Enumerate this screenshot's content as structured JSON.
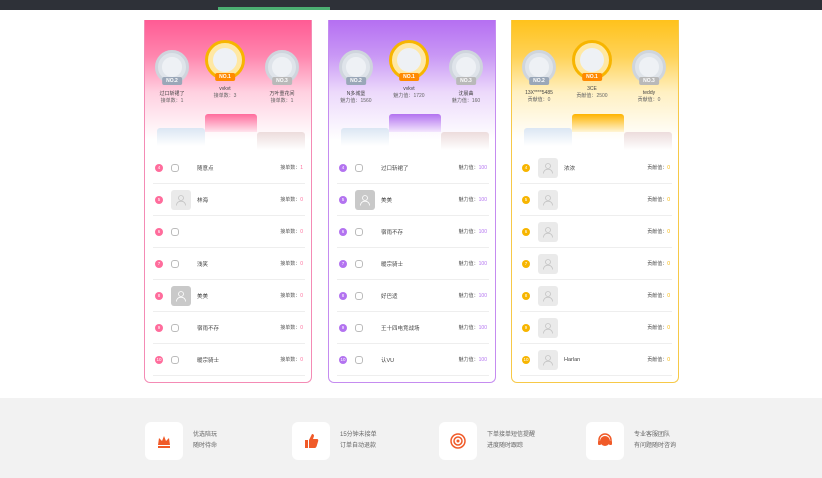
{
  "colors": {
    "pink": "#ff6c9c",
    "purple": "#b373f0",
    "gold": "#f7b500",
    "topbar": "#2e3138",
    "accent_bar": "#4caf72"
  },
  "boards": [
    {
      "theme": "pink",
      "top3": [
        {
          "badge": "NO.2",
          "name": "过口斩裙了",
          "label": "接单数：",
          "value": "1"
        },
        {
          "badge": "NO.1",
          "name": "vvkvt",
          "label": "接单数：",
          "value": "3"
        },
        {
          "badge": "NO.3",
          "name": "万叶重花间",
          "label": "接单数：",
          "value": "1"
        }
      ],
      "rows": [
        {
          "rank": "4",
          "avatar": "broken",
          "name": "随意点",
          "label": "接单数：",
          "value": "1"
        },
        {
          "rank": "5",
          "avatar": "default",
          "name": "林海",
          "label": "接单数：",
          "value": "0"
        },
        {
          "rank": "6",
          "avatar": "broken",
          "name": "",
          "label": "接单数：",
          "value": "0"
        },
        {
          "rank": "7",
          "avatar": "broken",
          "name": "浅笑",
          "label": "接单数：",
          "value": "0"
        },
        {
          "rank": "8",
          "avatar": "dark",
          "name": "美美",
          "label": "接单数：",
          "value": "0"
        },
        {
          "rank": "9",
          "avatar": "broken",
          "name": "宿雨不存",
          "label": "接单数：",
          "value": "0"
        },
        {
          "rank": "10",
          "avatar": "broken",
          "name": "暖宗骑士",
          "label": "接单数：",
          "value": "0"
        }
      ]
    },
    {
      "theme": "purple",
      "top3": [
        {
          "badge": "NO.2",
          "name": "N多城堡",
          "label": "魅力值：",
          "value": "1560"
        },
        {
          "badge": "NO.1",
          "name": "vvkvt",
          "label": "魅力值：",
          "value": "1720"
        },
        {
          "badge": "NO.3",
          "name": "沈晨曲",
          "label": "魅力值：",
          "value": "160"
        }
      ],
      "rows": [
        {
          "rank": "4",
          "avatar": "broken",
          "name": "过口斩裙了",
          "label": "魅力值：",
          "value": "100"
        },
        {
          "rank": "5",
          "avatar": "dark",
          "name": "美美",
          "label": "魅力值：",
          "value": "100"
        },
        {
          "rank": "6",
          "avatar": "broken",
          "name": "宿雨不存",
          "label": "魅力值：",
          "value": "100"
        },
        {
          "rank": "7",
          "avatar": "broken",
          "name": "暖宗骑士",
          "label": "魅力值：",
          "value": "100"
        },
        {
          "rank": "8",
          "avatar": "broken",
          "name": "好巴适",
          "label": "魅力值：",
          "value": "100"
        },
        {
          "rank": "9",
          "avatar": "broken",
          "name": "王十四电竞战场",
          "label": "魅力值：",
          "value": "100"
        },
        {
          "rank": "10",
          "avatar": "broken",
          "name": "认VU",
          "label": "魅力值：",
          "value": "100"
        }
      ]
    },
    {
      "theme": "gold",
      "top3": [
        {
          "badge": "NO.2",
          "name": "13X****5485",
          "label": "贡献值：",
          "value": "0"
        },
        {
          "badge": "NO.1",
          "name": "3CE",
          "label": "贡献值：",
          "value": "2500"
        },
        {
          "badge": "NO.3",
          "name": "teddy",
          "label": "贡献值：",
          "value": "0"
        }
      ],
      "rows": [
        {
          "rank": "4",
          "avatar": "default",
          "name": "浓浓",
          "label": "贡献值：",
          "value": "0"
        },
        {
          "rank": "5",
          "avatar": "default",
          "name": "",
          "label": "贡献值：",
          "value": "0"
        },
        {
          "rank": "6",
          "avatar": "default",
          "name": "",
          "label": "贡献值：",
          "value": "0"
        },
        {
          "rank": "7",
          "avatar": "default",
          "name": "",
          "label": "贡献值：",
          "value": "0"
        },
        {
          "rank": "8",
          "avatar": "default",
          "name": "",
          "label": "贡献值：",
          "value": "0"
        },
        {
          "rank": "9",
          "avatar": "default",
          "name": "",
          "label": "贡献值：",
          "value": "0"
        },
        {
          "rank": "10",
          "avatar": "default",
          "name": "Harlan",
          "label": "贡献值：",
          "value": "0"
        }
      ]
    }
  ],
  "footer": {
    "features": [
      {
        "icon": "crown-icon",
        "line1": "优选陪玩",
        "line2": "随时待命"
      },
      {
        "icon": "thumbs-up-icon",
        "line1": "15分钟未接单",
        "line2": "订单自动退款"
      },
      {
        "icon": "target-icon",
        "line1": "下单接单短信提醒",
        "line2": "进度随时跟踪"
      },
      {
        "icon": "headset-icon",
        "line1": "专业客服团队",
        "line2": "有问题随时咨询"
      }
    ]
  }
}
